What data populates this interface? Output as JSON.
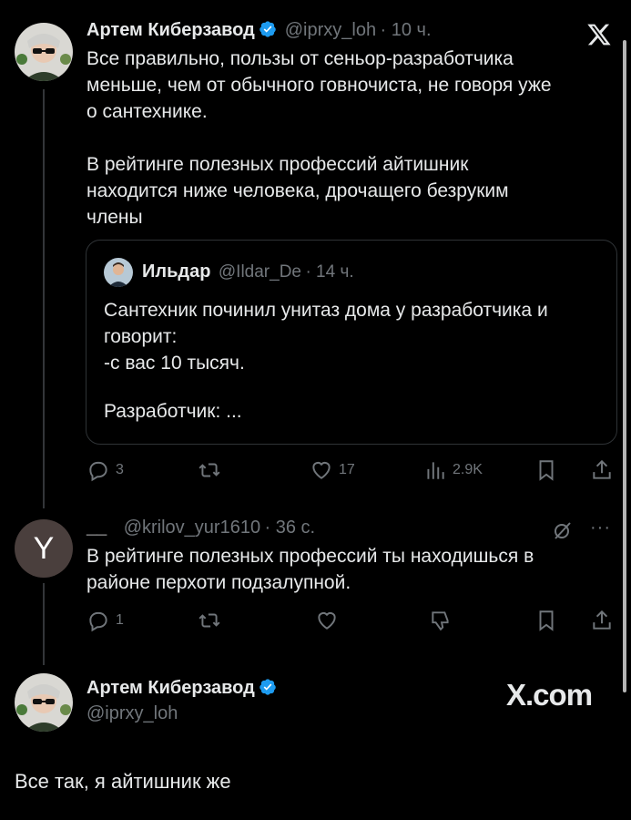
{
  "close_icon": "x-logo-icon",
  "tweet1": {
    "author_name": "Артем Киберзавод",
    "handle": "@iprxy_loh",
    "time": "· 10 ч.",
    "text_lines": [
      "Все правильно, пользы от сеньор-разработчика",
      "меньше, чем от обычного говночиста, не говоря уже",
      "о сантехнике."
    ],
    "text_lines2": [
      "В рейтинге полезных профессий айтишник",
      "находится ниже человека, дрочащего безруким",
      "члены"
    ],
    "quote": {
      "author_name": "Ильдар",
      "handle": "@Ildar_De",
      "time": "· 14 ч.",
      "lines": [
        "Сантехник починил унитаз дома у разработчика и",
        "говорит:",
        "-с вас 10 тысяч."
      ],
      "line_last": "Разработчик: ..."
    },
    "actions": {
      "replies": "3",
      "retweets": "",
      "likes": "17",
      "views": "2.9K"
    }
  },
  "tweet2": {
    "avatar_letter": "Y",
    "author_name": "__",
    "handle": "@krilov_yur1610",
    "time": "· 36 с.",
    "text_lines": [
      "В рейтинге полезных профессий ты находишься в",
      "районе перхоти подзалупной."
    ],
    "actions": {
      "replies": "1"
    }
  },
  "tweet3": {
    "author_name": "Артем Киберзавод",
    "handle": "@iprxy_loh",
    "watermark": "X.com",
    "text": "Все так, я айтишник же"
  },
  "colors": {
    "background": "#000000",
    "text": "#e7e9ea",
    "muted": "#71767b",
    "verified": "#1d9bf0",
    "border": "#2f3336"
  }
}
